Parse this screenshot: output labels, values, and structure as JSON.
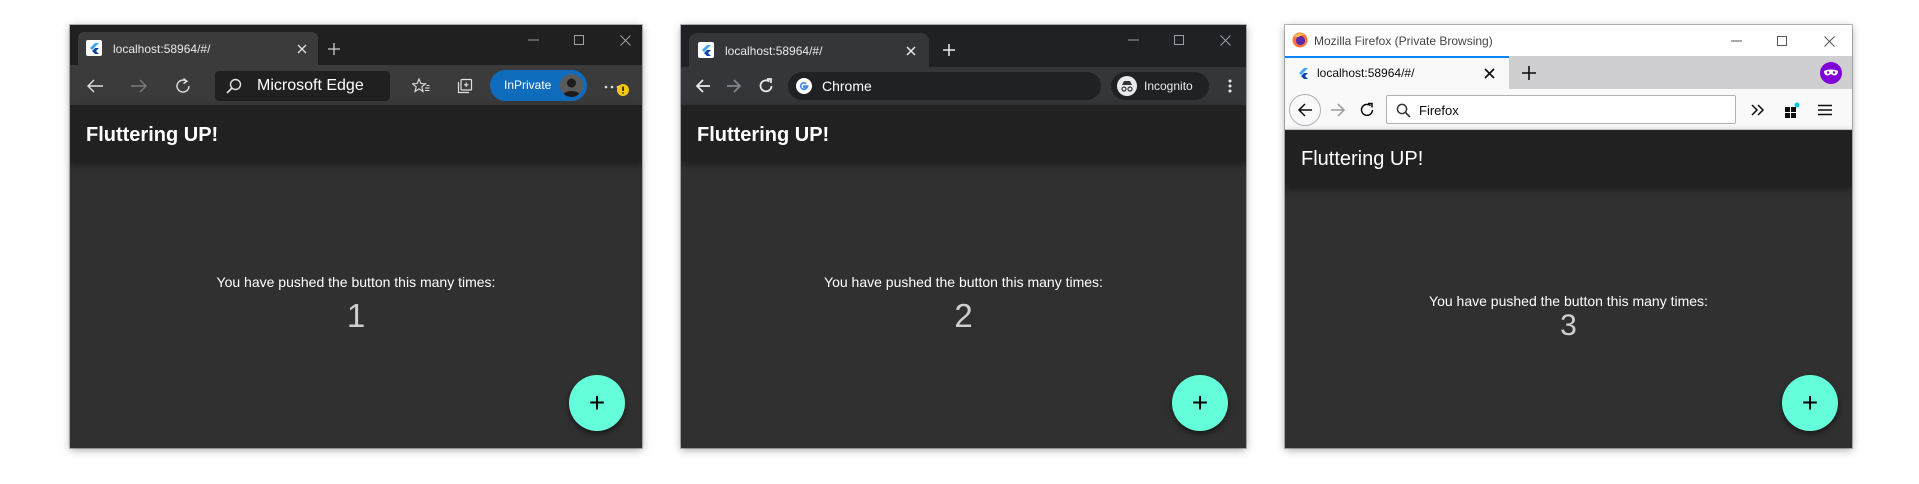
{
  "edge": {
    "tab_title": "localhost:58964/#/",
    "address_text": "Microsoft Edge",
    "inprivate_label": "InPrivate",
    "app_title": "Fluttering UP!",
    "counter_label": "You have pushed the button this many times:",
    "counter_value": "1",
    "fab_label": "+"
  },
  "chrome": {
    "tab_title": "localhost:58964/#/",
    "address_text": "Chrome",
    "incognito_label": "Incognito",
    "app_title": "Fluttering UP!",
    "counter_label": "You have pushed the button this many times:",
    "counter_value": "2",
    "fab_label": "+"
  },
  "firefox": {
    "window_title": "Mozilla Firefox (Private Browsing)",
    "tab_title": "localhost:58964/#/",
    "address_text": "Firefox",
    "app_title": "Fluttering UP!",
    "counter_label": "You have pushed the button this many times:",
    "counter_value": "3",
    "fab_label": "+"
  },
  "colors": {
    "fab": "#64ffda",
    "app_bar": "#212121",
    "app_body": "#303030",
    "edge_inprivate": "#0f6cbd",
    "firefox_private": "#8000d7"
  }
}
